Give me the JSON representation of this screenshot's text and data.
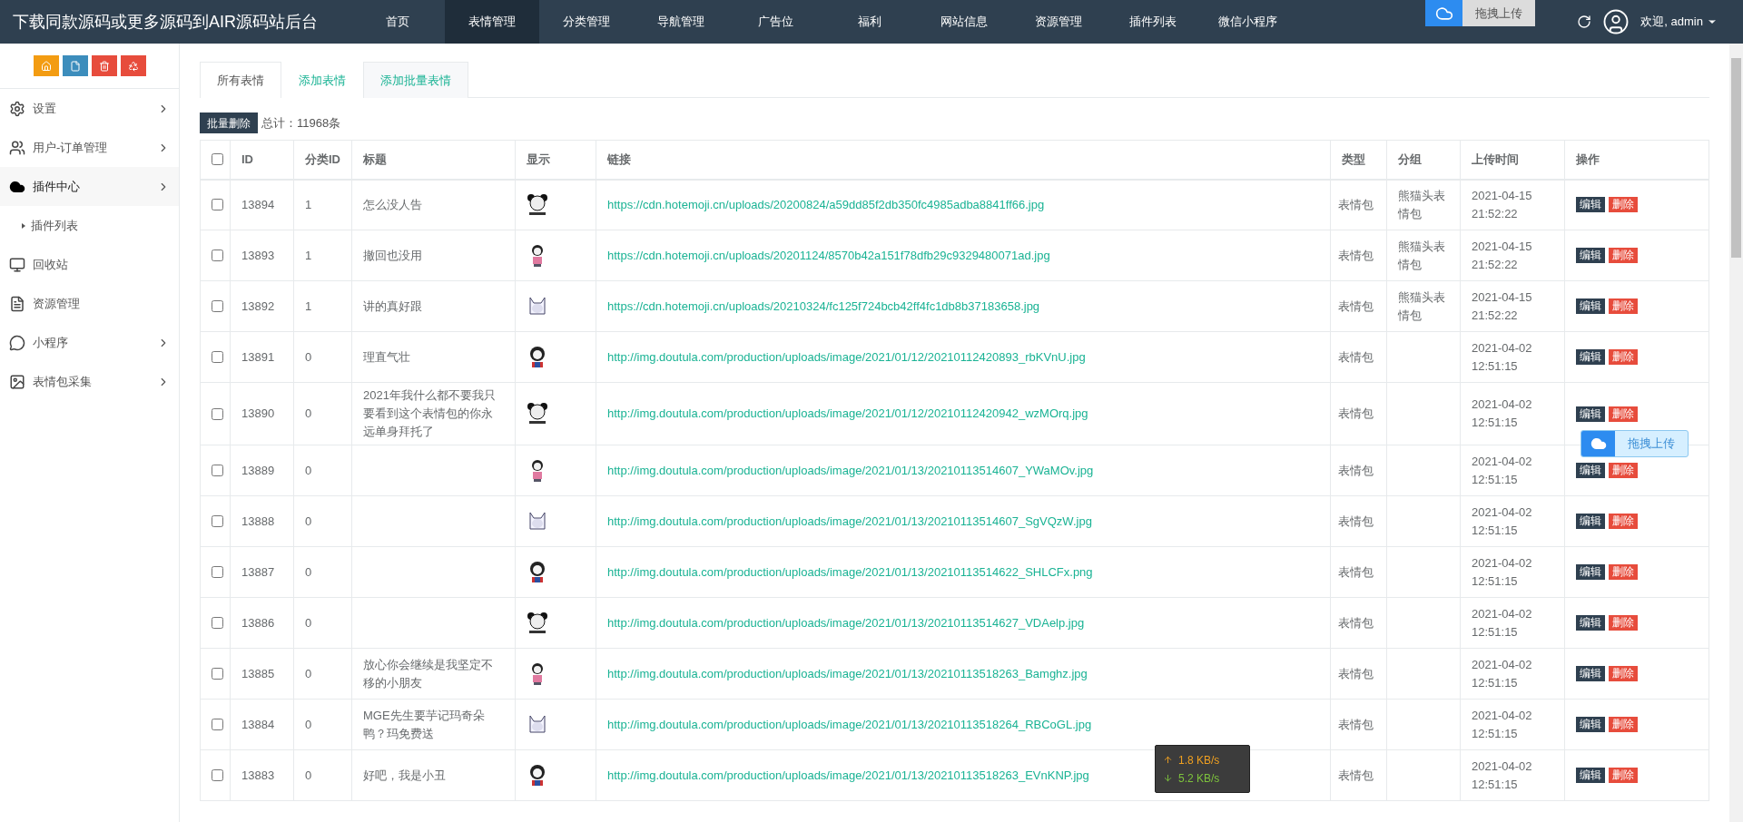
{
  "header": {
    "brand": "下载同款源码或更多源码到AIR源码站后台",
    "nav": [
      {
        "label": "首页",
        "selected": false
      },
      {
        "label": "表情管理",
        "selected": true
      },
      {
        "label": "分类管理",
        "selected": false
      },
      {
        "label": "导航管理",
        "selected": false
      },
      {
        "label": "广告位",
        "selected": false
      },
      {
        "label": "福利",
        "selected": false
      },
      {
        "label": "网站信息",
        "selected": false
      },
      {
        "label": "资源管理",
        "selected": false
      },
      {
        "label": "插件列表",
        "selected": false
      },
      {
        "label": "微信小程序",
        "selected": false
      }
    ],
    "user": "欢迎, admin"
  },
  "sidebar": {
    "items": [
      {
        "label": "设置",
        "selected": false,
        "has_arrow": true
      },
      {
        "label": "用户-订单管理",
        "selected": false,
        "has_arrow": true
      },
      {
        "label": "插件中心",
        "selected": true,
        "has_arrow": true,
        "children": [
          {
            "label": "插件列表"
          }
        ]
      },
      {
        "label": "回收站",
        "selected": false,
        "has_arrow": false
      },
      {
        "label": "资源管理",
        "selected": false,
        "has_arrow": false
      },
      {
        "label": "小程序",
        "selected": false,
        "has_arrow": true
      },
      {
        "label": "表情包采集",
        "selected": false,
        "has_arrow": true
      }
    ]
  },
  "tabs": [
    {
      "label": "所有表情",
      "selected": true,
      "highlighted": false
    },
    {
      "label": "添加表情",
      "selected": false,
      "highlighted": false
    },
    {
      "label": "添加批量表情",
      "selected": false,
      "highlighted": true
    }
  ],
  "toolbar": {
    "bulk_delete": "批量删除",
    "total": "总计：11968条"
  },
  "table": {
    "select_all": {
      "checked": false
    },
    "columns": [
      "ID",
      "分类ID",
      "标题",
      "显示",
      "链接",
      "类型",
      "分组",
      "上传时间",
      "操作"
    ],
    "rows": [
      {
        "checked": false,
        "id": "13894",
        "category_id": "1",
        "title": "怎么没人告",
        "link": "https://cdn.hotemoji.cn/uploads/20200824/a59dd85f2db350fc4985adba8841ff66.jpg",
        "type": "表情包",
        "group": "熊猫头表情包",
        "time": "2021-04-15 21:52:22",
        "actions": [
          {
            "label": "编辑",
            "kind": "edit"
          },
          {
            "label": "删除",
            "kind": "delete"
          }
        ]
      },
      {
        "checked": false,
        "id": "13893",
        "category_id": "1",
        "title": "撤回也没用",
        "link": "https://cdn.hotemoji.cn/uploads/20201124/8570b42a151f78dfb29c9329480071ad.jpg",
        "type": "表情包",
        "group": "熊猫头表情包",
        "time": "2021-04-15 21:52:22",
        "actions": [
          {
            "label": "编辑",
            "kind": "edit"
          },
          {
            "label": "删除",
            "kind": "delete"
          }
        ]
      },
      {
        "checked": false,
        "id": "13892",
        "category_id": "1",
        "title": "讲的真好跟",
        "link": "https://cdn.hotemoji.cn/uploads/20210324/fc125f724bcb42ff4fc1db8b37183658.jpg",
        "type": "表情包",
        "group": "熊猫头表情包",
        "time": "2021-04-15 21:52:22",
        "actions": [
          {
            "label": "编辑",
            "kind": "edit"
          },
          {
            "label": "删除",
            "kind": "delete"
          }
        ]
      },
      {
        "checked": false,
        "id": "13891",
        "category_id": "0",
        "title": "理直气壮",
        "link": "http://img.doutula.com/production/uploads/image/2021/01/12/20210112420893_rbKVnU.jpg",
        "type": "表情包",
        "time": "2021-04-02 12:51:15",
        "actions": [
          {
            "label": "编辑",
            "kind": "edit"
          },
          {
            "label": "删除",
            "kind": "delete"
          }
        ]
      },
      {
        "checked": false,
        "id": "13890",
        "category_id": "0",
        "title": "2021年我什么都不要我只要看到这个表情包的你永远单身拜托了",
        "link": "http://img.doutula.com/production/uploads/image/2021/01/12/20210112420942_wzMOrq.jpg",
        "type": "表情包",
        "time": "2021-04-02 12:51:15",
        "actions": [
          {
            "label": "编辑",
            "kind": "edit"
          },
          {
            "label": "删除",
            "kind": "delete"
          }
        ]
      },
      {
        "checked": false,
        "id": "13889",
        "category_id": "0",
        "link": "http://img.doutula.com/production/uploads/image/2021/01/13/20210113514607_YWaMOv.jpg",
        "type": "表情包",
        "time": "2021-04-02 12:51:15",
        "actions": [
          {
            "label": "编辑",
            "kind": "edit"
          },
          {
            "label": "删除",
            "kind": "delete"
          }
        ]
      },
      {
        "checked": false,
        "id": "13888",
        "category_id": "0",
        "link": "http://img.doutula.com/production/uploads/image/2021/01/13/20210113514607_SgVQzW.jpg",
        "type": "表情包",
        "time": "2021-04-02 12:51:15",
        "actions": [
          {
            "label": "编辑",
            "kind": "edit"
          },
          {
            "label": "删除",
            "kind": "delete"
          }
        ]
      },
      {
        "checked": false,
        "id": "13887",
        "category_id": "0",
        "link": "http://img.doutula.com/production/uploads/image/2021/01/13/20210113514622_SHLCFx.png",
        "type": "表情包",
        "time": "2021-04-02 12:51:15",
        "actions": [
          {
            "label": "编辑",
            "kind": "edit"
          },
          {
            "label": "删除",
            "kind": "delete"
          }
        ]
      },
      {
        "checked": false,
        "id": "13886",
        "category_id": "0",
        "link": "http://img.doutula.com/production/uploads/image/2021/01/13/20210113514627_VDAelp.jpg",
        "type": "表情包",
        "time": "2021-04-02 12:51:15",
        "actions": [
          {
            "label": "编辑",
            "kind": "edit"
          },
          {
            "label": "删除",
            "kind": "delete"
          }
        ]
      },
      {
        "checked": false,
        "id": "13885",
        "category_id": "0",
        "title": "放心你会继续是我坚定不移的小朋友",
        "link": "http://img.doutula.com/production/uploads/image/2021/01/13/20210113518263_Bamghz.jpg",
        "type": "表情包",
        "time": "2021-04-02 12:51:15",
        "actions": [
          {
            "label": "编辑",
            "kind": "edit"
          },
          {
            "label": "删除",
            "kind": "delete"
          }
        ]
      },
      {
        "checked": false,
        "id": "13884",
        "category_id": "0",
        "title": "MGE先生要芋记玛奇朵鸭？玛免费送",
        "link": "http://img.doutula.com/production/uploads/image/2021/01/13/20210113518264_RBCoGL.jpg",
        "type": "表情包",
        "time": "2021-04-02 12:51:15",
        "actions": [
          {
            "label": "编辑",
            "kind": "edit"
          },
          {
            "label": "删除",
            "kind": "delete"
          }
        ]
      },
      {
        "checked": false,
        "id": "13883",
        "category_id": "0",
        "title": "好吧，我是小丑",
        "link": "http://img.doutula.com/production/uploads/image/2021/01/13/20210113518263_EVnKNP.jpg",
        "type": "表情包",
        "time": "2021-04-02 12:51:15",
        "actions": [
          {
            "label": "编辑",
            "kind": "edit"
          },
          {
            "label": "删除",
            "kind": "delete"
          }
        ]
      }
    ]
  },
  "header_upload": {
    "label": "拖拽上传"
  },
  "floating_upload": {
    "label": "拖拽上传"
  },
  "net_speed": {
    "up": "1.8 KB/s",
    "down": "5.2 KB/s"
  }
}
